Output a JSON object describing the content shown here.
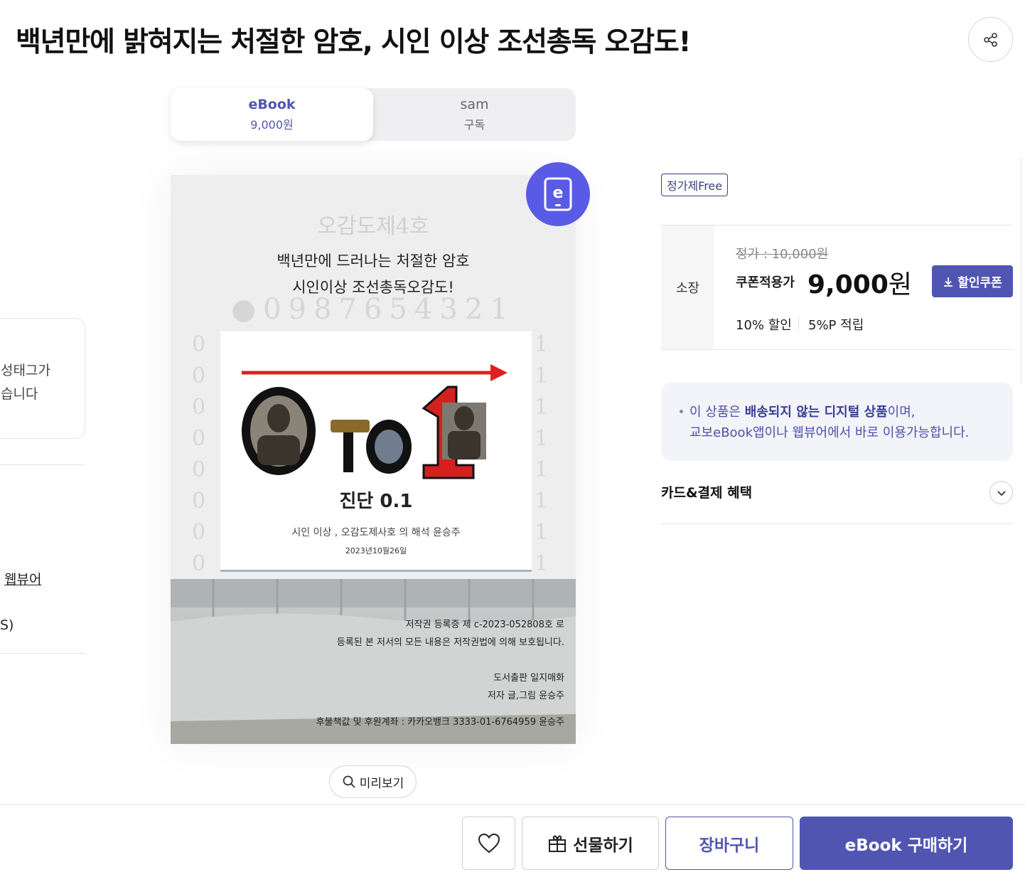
{
  "header": {
    "title": "백년만에 밝혀지는 처절한 암호, 시인 이상 조선총독 오감도!",
    "share_icon": "share-icon"
  },
  "format_tabs": [
    {
      "name": "eBook",
      "sub": "9,000원",
      "active": true
    },
    {
      "name": "sam",
      "sub": "구독",
      "active": false
    }
  ],
  "left_panel": {
    "line1": "성태그가",
    "line2": "습니다",
    "viewer_link": "웹뷰어",
    "platform_text": "S)"
  },
  "cover": {
    "title_line1": "백년만에 드러나는 처절한 암호",
    "title_line2": "시인이상 조선총독오감도!",
    "main_title": "진단 0.1",
    "subtitle": "시인 이상 , 오감도제사호  의 해석    윤승주",
    "date": "2023년10월26일",
    "copyright": "저작권 등록증 제 c-2023-052808호 로",
    "protected": "등록된 본 저서의 모든 내용은 저작권법에 의해 보호됩니다.",
    "publisher": "도서출판 일지매화",
    "author": "저자 글,그림 윤승주",
    "account": "후불책값 및 후원계좌 : 카카오뱅크 3333-01-6764959 윤승주",
    "badge_letter": "e"
  },
  "preview": {
    "label": "미리보기"
  },
  "price": {
    "badge": "정가제Free",
    "type_label": "소장",
    "original": "정가 : 10,000원",
    "coupon_label": "쿠폰적용가",
    "coupon_price": "9,000",
    "currency": "원",
    "coupon_button": "할인쿠폰",
    "discount": "10% 할인",
    "point": "5%P 적립"
  },
  "notice": {
    "line1_pre": "이 상품은 ",
    "line1_bold": "배송되지 않는 디지털 상품",
    "line1_post": "이며,",
    "line2": "교보eBook앱이나 웹뷰어에서 바로 이용가능합니다."
  },
  "benefits": {
    "label": "카드&결제 혜택"
  },
  "actions": {
    "gift": "선물하기",
    "cart": "장바구니",
    "buy": "eBook 구매하기"
  },
  "colors": {
    "accent": "#5055b1",
    "badge_purple": "#595be6",
    "notice_bg": "#f3f3fa"
  }
}
